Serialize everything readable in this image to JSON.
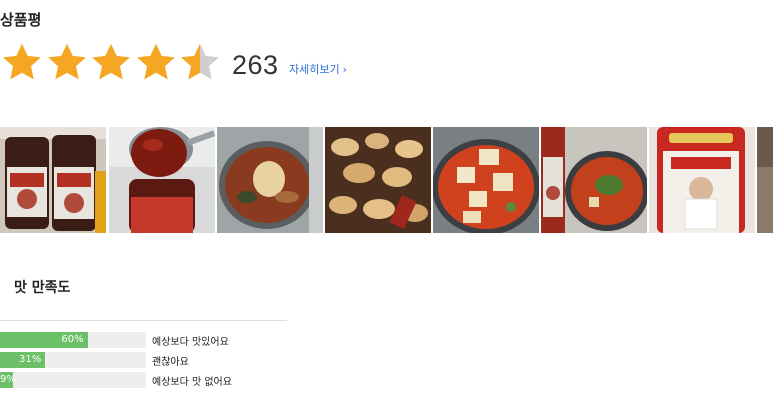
{
  "rating": {
    "title": "상품평",
    "stars_value": 4.5,
    "stars_max": 5,
    "review_count": "263",
    "detail_link_label": "자세히보기",
    "star_color": "#f5a623",
    "star_empty_color": "#cfcfcf"
  },
  "photos": [
    {
      "name": "photo-sauce-jars"
    },
    {
      "name": "photo-spoon-sauce"
    },
    {
      "name": "photo-stew-bowl"
    },
    {
      "name": "photo-stir-fried-mushrooms"
    },
    {
      "name": "photo-tofu-stew"
    },
    {
      "name": "photo-jar-and-stew"
    },
    {
      "name": "photo-product-bottle"
    },
    {
      "name": "photo-partial"
    }
  ],
  "taste": {
    "title": "맛 만족도",
    "accent_color": "#6cc067",
    "items": [
      {
        "percent": 60,
        "percent_label": "60%",
        "label": "예상보다 맛있어요"
      },
      {
        "percent": 31,
        "percent_label": "31%",
        "label": "괜찮아요"
      },
      {
        "percent": 9,
        "percent_label": "9%",
        "label": "예상보다 맛 없어요"
      }
    ]
  }
}
